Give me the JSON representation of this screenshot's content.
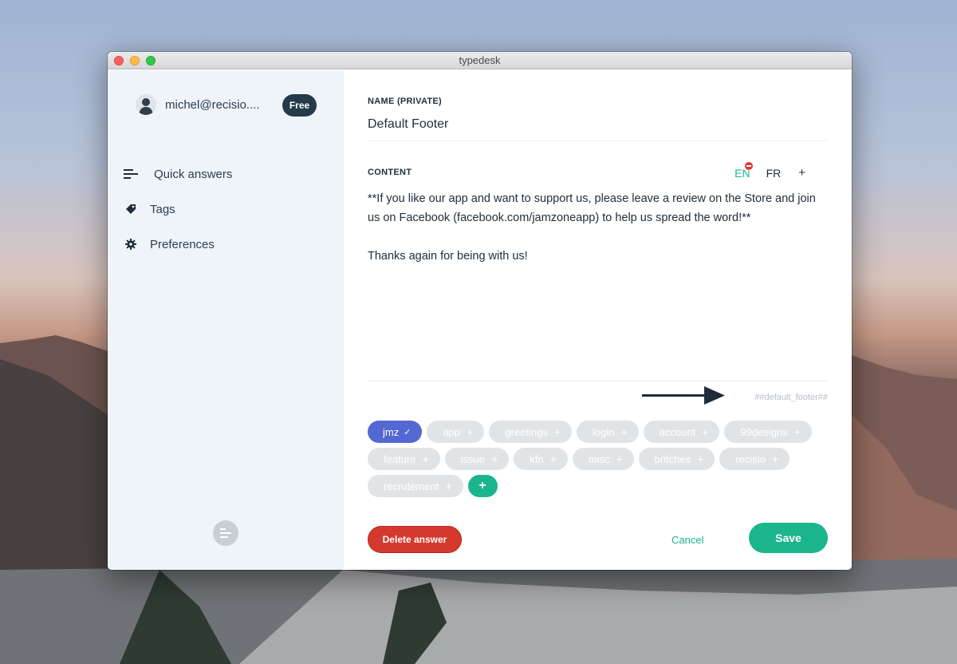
{
  "window": {
    "title": "typedesk"
  },
  "sidebar": {
    "account_email": "michel@recisio....",
    "plan": "Free",
    "nav": [
      {
        "label": "Quick answers",
        "icon": "lines-icon"
      },
      {
        "label": "Tags",
        "icon": "tag-icon"
      },
      {
        "label": "Preferences",
        "icon": "gear-icon"
      }
    ]
  },
  "editor": {
    "name_label": "NAME (PRIVATE)",
    "name_value": "Default Footer",
    "content_label": "CONTENT",
    "languages": [
      "EN",
      "FR"
    ],
    "active_language": "EN",
    "add_language": "+",
    "content_lines": [
      "**If you like our app and want to support us, please leave a review on the Store and join us on Facebook (facebook.com/jamzoneapp) to help us spread the word!**",
      "Thanks again for being with us!"
    ],
    "shortcut": "##default_footer##"
  },
  "tags": {
    "selected": "jmz",
    "selected_mark": "✓",
    "add_mark": "+",
    "items": [
      "app",
      "greetings",
      "login",
      "account",
      "99designs",
      "feature",
      "issue",
      "kfn",
      "misc",
      "britches",
      "recisio",
      "recrutement"
    ]
  },
  "actions": {
    "delete": "Delete answer",
    "cancel": "Cancel",
    "save": "Save"
  },
  "colors": {
    "accent": "#1ab58c",
    "selected_tag": "#5468d4",
    "danger": "#d5392e",
    "sidebar_bg": "#eff3fa"
  }
}
